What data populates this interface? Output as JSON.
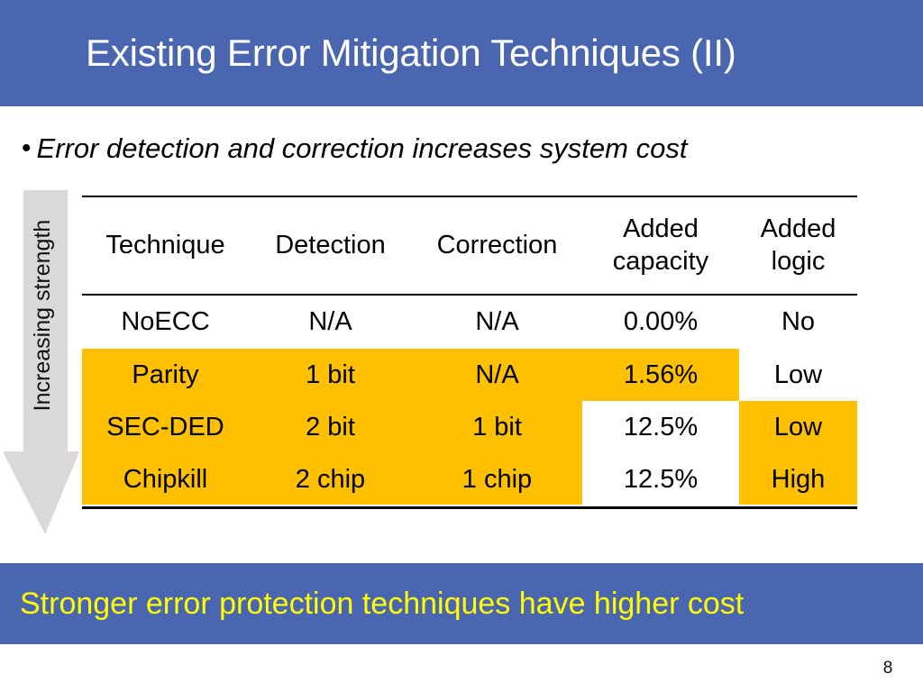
{
  "slide": {
    "title": "Existing Error Mitigation Techniques (II)",
    "title_bar_color": "#4A66B0",
    "number": "8"
  },
  "bullet": {
    "marker": "bullet-dot",
    "text": "Error detection and correction increases system cost"
  },
  "arrow": {
    "label": "Increasing strength",
    "color": "#D9D9D9",
    "direction": "down"
  },
  "table": {
    "headers": [
      {
        "label": "Technique",
        "color": "#000000"
      },
      {
        "label": "Detection",
        "color": "#000000"
      },
      {
        "label": "Correction",
        "color": "#000000"
      },
      {
        "line1": "Added",
        "line2": "capacity",
        "color": "#FF0000"
      },
      {
        "line1": "Added",
        "line2": "logic",
        "color": "#FF0000"
      }
    ],
    "highlight_color": "#FFC000",
    "rows": [
      {
        "technique": "NoECC",
        "detection": "N/A",
        "correction": "N/A",
        "added_capacity": "0.00%",
        "added_logic": "No",
        "fills": [
          "white",
          "white",
          "white",
          "white",
          "white"
        ]
      },
      {
        "technique": "Parity",
        "detection": "1 bit",
        "correction": "N/A",
        "added_capacity": "1.56%",
        "added_logic": "Low",
        "fills": [
          "yellow",
          "yellow",
          "yellow",
          "yellow",
          "white"
        ]
      },
      {
        "technique": "SEC-DED",
        "detection": "2 bit",
        "correction": "1 bit",
        "added_capacity": "12.5%",
        "added_logic": "Low",
        "fills": [
          "yellow",
          "yellow",
          "yellow",
          "white",
          "yellow"
        ]
      },
      {
        "technique": "Chipkill",
        "detection": "2 chip",
        "correction": "1 chip",
        "added_capacity": "12.5%",
        "added_logic": "High",
        "fills": [
          "yellow",
          "yellow",
          "yellow",
          "white",
          "yellow"
        ]
      }
    ]
  },
  "banner": {
    "text": "Stronger error protection techniques have higher cost",
    "background_color": "#4A66B0",
    "text_color": "#FFFF00"
  }
}
